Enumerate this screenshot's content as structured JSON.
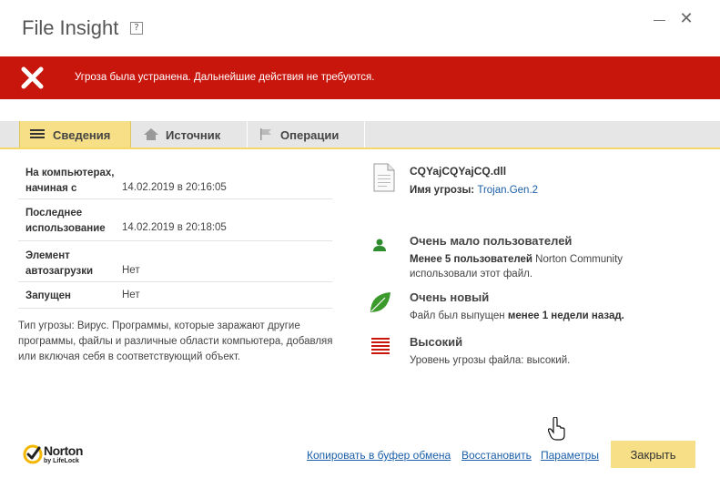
{
  "window": {
    "title": "File Insight",
    "help_label": "?",
    "close_symbol": "✕"
  },
  "alert": {
    "message": "Угроза была устранена. Дальнейшие действия не требуются.",
    "color": "#c8160d"
  },
  "tabs": [
    {
      "label": "Сведения",
      "active": true,
      "icon": "list-icon"
    },
    {
      "label": "Источник",
      "active": false,
      "icon": "home-icon"
    },
    {
      "label": "Операции",
      "active": false,
      "icon": "flag-icon"
    }
  ],
  "details": [
    {
      "label_line1": "На компьютерах,",
      "label_line2": "начиная с",
      "value": "14.02.2019 в 20:16:05"
    },
    {
      "label_line1": "Последнее",
      "label_line2": "использование",
      "value": "14.02.2019 в 20:18:05"
    },
    {
      "label_line1": "Элемент",
      "label_line2": "автозагрузки",
      "value": "Нет"
    },
    {
      "label_line1": "Запущен",
      "label_line2": "",
      "value": "Нет"
    }
  ],
  "threat_description": "Тип угрозы: Вирус. Программы, которые заражают другие программы, файлы и различные области компьютера, добавляя или включая себя в соответствующий объект.",
  "file": {
    "name": "CQYajCQYajCQ.dll",
    "threat_label": "Имя угрозы:",
    "threat_name": "Trojan.Gen.2"
  },
  "info": {
    "users": {
      "title": "Очень мало пользователей",
      "bold": "Менее 5 пользователей",
      "text_after": " Norton Community",
      "line2": "использовали этот файл."
    },
    "age": {
      "title": "Очень новый",
      "text_before": "Файл был выпущен ",
      "bold": "менее 1 недели назад."
    },
    "risk": {
      "title": "Высокий",
      "text": "Уровень угрозы файла: высокий."
    }
  },
  "brand": {
    "name": "Norton",
    "sub": "by LifeLock"
  },
  "footer": {
    "copy_label": "Копировать в буфер обмена",
    "restore_label": "Восстановить",
    "settings_label": "Параметры",
    "close_label": "Закрыть"
  },
  "colors": {
    "accent_yellow": "#f7df87",
    "link_blue": "#1a5ea8",
    "green": "#2e8b2e",
    "risk_red": "#c8160d"
  }
}
